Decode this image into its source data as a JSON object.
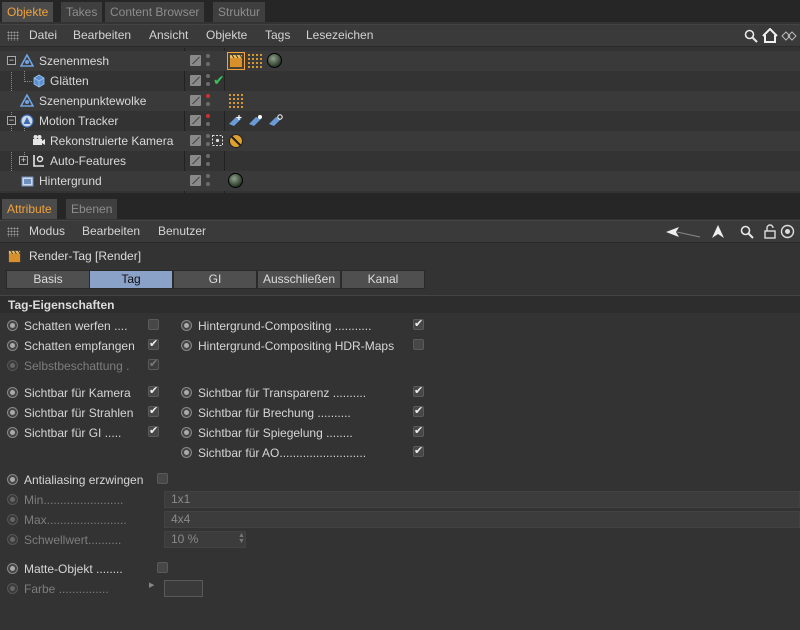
{
  "top_tabs": [
    "Objekte",
    "Takes",
    "Content Browser",
    "Struktur"
  ],
  "object_menu": [
    "Datei",
    "Bearbeiten",
    "Ansicht",
    "Objekte",
    "Tags",
    "Lesezeichen"
  ],
  "tree": [
    {
      "label": "Szenenmesh",
      "icon": "mesh-triangle-icon"
    },
    {
      "label": "Glätten",
      "icon": "smoothing-cube-icon"
    },
    {
      "label": "Szenenpunktewolke",
      "icon": "pointcloud-triangle-icon"
    },
    {
      "label": "Motion Tracker",
      "icon": "motion-tracker-icon"
    },
    {
      "label": "Rekonstruierte Kamera",
      "icon": "camera-icon"
    },
    {
      "label": "Auto-Features",
      "icon": "auto-features-icon"
    },
    {
      "label": "Hintergrund",
      "icon": "background-icon"
    }
  ],
  "attr_tabs": [
    "Attribute",
    "Ebenen"
  ],
  "attr_menu": [
    "Modus",
    "Bearbeiten",
    "Benutzer"
  ],
  "title": "Render-Tag [Render]",
  "panel_tabs": [
    "Basis",
    "Tag",
    "GI",
    "Ausschließen",
    "Kanal"
  ],
  "section_title": "Tag-Eigenschaften",
  "props": {
    "schatten_werfen": {
      "label": "Schatten werfen",
      "dots": "....",
      "checked": false
    },
    "schatten_empfangen": {
      "label": "Schatten empfangen",
      "checked": true
    },
    "selbstbeschattung": {
      "label": "Selbstbeschattung",
      "dots": ".",
      "checked": true
    },
    "hg_compositing": {
      "label": "Hintergrund-Compositing",
      "dots": "...........",
      "checked": true
    },
    "hg_compositing_hdr": {
      "label": "Hintergrund-Compositing HDR-Maps",
      "checked": false
    },
    "sichtbar_kamera": {
      "label": "Sichtbar für Kamera",
      "checked": true
    },
    "sichtbar_strahlen": {
      "label": "Sichtbar für Strahlen",
      "checked": true
    },
    "sichtbar_gi": {
      "label": "Sichtbar für GI",
      "dots": ".....",
      "checked": true
    },
    "sichtbar_transparenz": {
      "label": "Sichtbar für Transparenz",
      "dots": "..........",
      "checked": true
    },
    "sichtbar_brechung": {
      "label": "Sichtbar für Brechung",
      "dots": "..........",
      "checked": true
    },
    "sichtbar_spiegelung": {
      "label": "Sichtbar für Spiegelung",
      "dots": "........",
      "checked": true
    },
    "sichtbar_ao": {
      "label": "Sichtbar für AO",
      "dots": "..........................",
      "checked": true
    },
    "antialiasing": {
      "label": "Antialiasing erzwingen",
      "checked": false
    },
    "min": {
      "label": "Min",
      "dots": "........................",
      "value": "1x1"
    },
    "max": {
      "label": "Max",
      "dots": "........................",
      "value": "4x4"
    },
    "schwellwert": {
      "label": "Schwellwert",
      "dots": "..........",
      "value": "10 %"
    },
    "matte": {
      "label": "Matte-Objekt",
      "dots": "........",
      "checked": false
    },
    "farbe": {
      "label": "Farbe",
      "dots": "..............."
    }
  },
  "check_glyph": "✔"
}
